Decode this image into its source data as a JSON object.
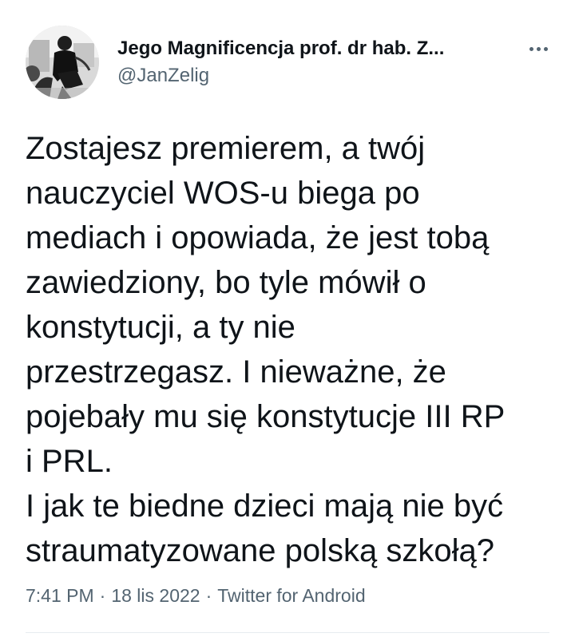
{
  "author": {
    "display_name": "Jego Magnificencja prof. dr hab. Z...",
    "handle": "@JanZelig",
    "avatar": "black-and-white-photo-avatar"
  },
  "more_icon": "ellipsis-icon",
  "tweet": {
    "lines": [
      "Zostajesz premierem, a twój",
      "nauczyciel WOS-u biega po",
      "mediach i opowiada, że jest tobą",
      "zawiedziony, bo tyle mówił o",
      "konstytucji, a ty nie",
      "przestrzegasz. I nieważne, że",
      "pojebały mu się konstytucje III RP",
      "i PRL.",
      "I jak te biedne dzieci mają nie być",
      "straumatyzowane polską szkołą?"
    ]
  },
  "meta": {
    "time": "7:41 PM",
    "separator": "·",
    "date": "18 lis 2022",
    "source": "Twitter for Android"
  },
  "colors": {
    "text": "#0f1419",
    "secondary": "#536471",
    "divider": "#e6ecf0"
  }
}
